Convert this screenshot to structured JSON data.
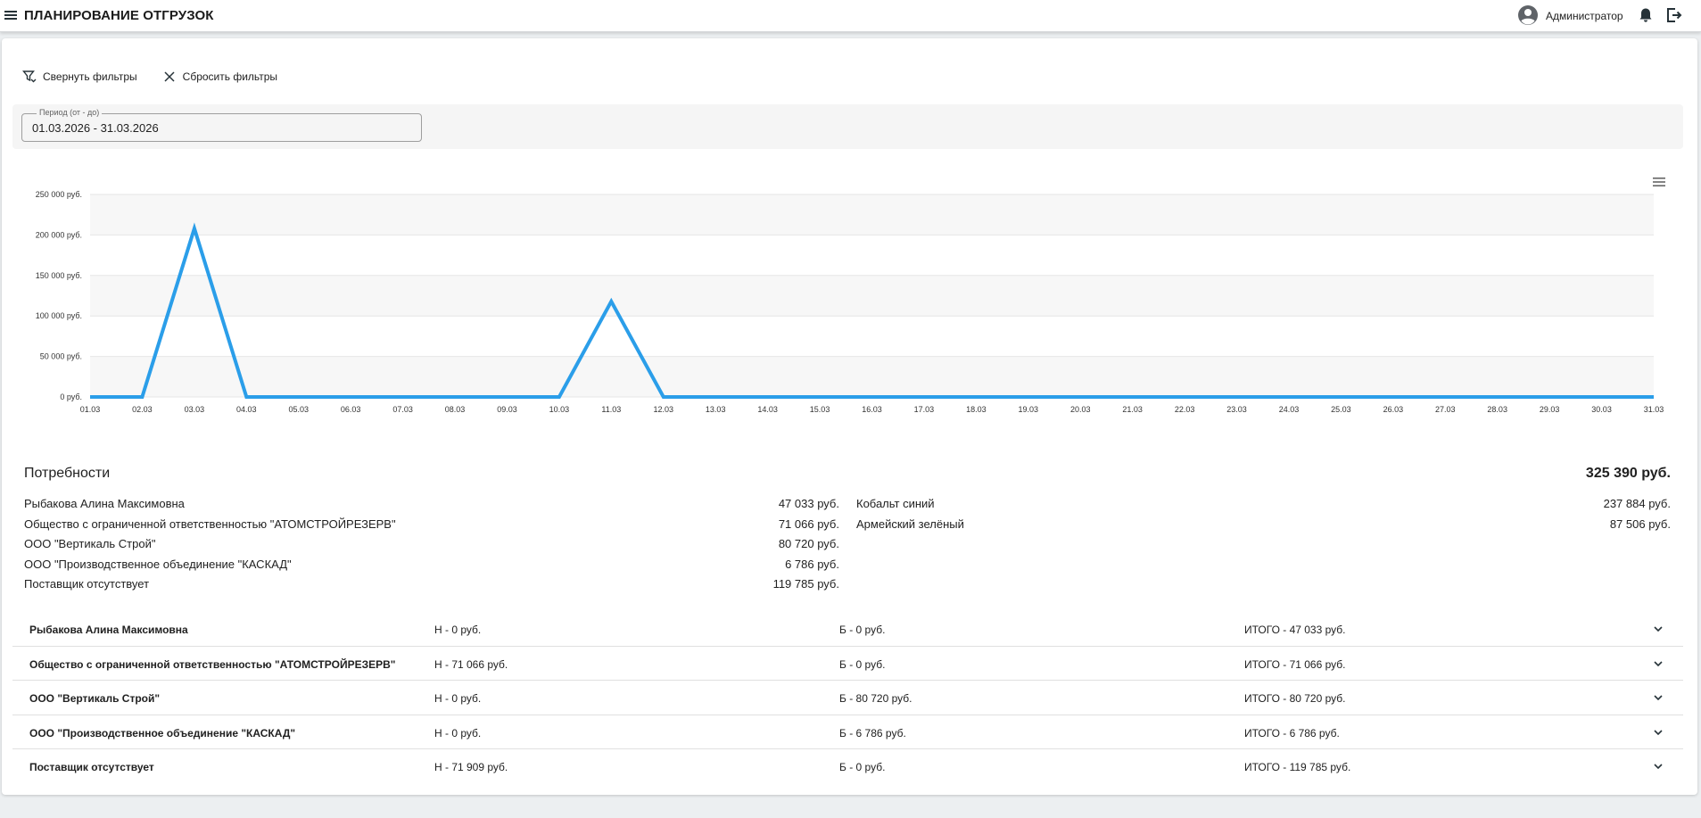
{
  "header": {
    "title": "ПЛАНИРОВАНИЕ ОТГРУЗОК",
    "user_name": "Администратор"
  },
  "filters": {
    "collapse_label": "Свернуть фильтры",
    "reset_label": "Сбросить фильтры",
    "period_label": "Период (от - до)",
    "period_value": "01.03.2026 - 31.03.2026"
  },
  "chart_data": {
    "type": "line",
    "categories": [
      "01.03",
      "02.03",
      "03.03",
      "04.03",
      "05.03",
      "06.03",
      "07.03",
      "08.03",
      "09.03",
      "10.03",
      "11.03",
      "12.03",
      "13.03",
      "14.03",
      "15.03",
      "16.03",
      "17.03",
      "18.03",
      "19.03",
      "20.03",
      "21.03",
      "22.03",
      "23.03",
      "24.03",
      "25.03",
      "26.03",
      "27.03",
      "28.03",
      "29.03",
      "30.03",
      "31.03"
    ],
    "values": [
      0,
      0,
      208000,
      0,
      0,
      0,
      0,
      0,
      0,
      0,
      118000,
      0,
      0,
      0,
      0,
      0,
      0,
      0,
      0,
      0,
      0,
      0,
      0,
      0,
      0,
      0,
      0,
      0,
      0,
      0,
      0
    ],
    "ylim": [
      0,
      250000
    ],
    "yticks": [
      0,
      50000,
      100000,
      150000,
      200000,
      250000
    ],
    "ytick_labels": [
      "0 руб.",
      "50 000 руб.",
      "100 000 руб.",
      "150 000 руб.",
      "200 000 руб.",
      "250 000 руб."
    ],
    "color": "#2b9ee9",
    "grid": true
  },
  "needs": {
    "title": "Потребности",
    "total": "325 390 руб.",
    "suppliers": [
      {
        "name": "Рыбакова Алина Максимовна",
        "amount": "47 033 руб."
      },
      {
        "name": "Общество с ограниченной ответственностью \"АТОМСТРОЙРЕЗЕРВ\"",
        "amount": "71 066 руб."
      },
      {
        "name": "ООО \"Вертикаль Строй\"",
        "amount": "80 720 руб."
      },
      {
        "name": "ООО \"Производственное объединение \"КАСКАД\"",
        "amount": "6 786 руб."
      },
      {
        "name": "Поставщик отсутствует",
        "amount": "119 785 руб."
      }
    ],
    "colors": [
      {
        "name": "Кобальт синий",
        "amount": "237 884 руб."
      },
      {
        "name": "Армейский зелёный",
        "amount": "87 506 руб."
      }
    ]
  },
  "rows": [
    {
      "name": "Рыбакова Алина Максимовна",
      "n": "Н - 0 руб.",
      "b": "Б - 0 руб.",
      "total": "ИТОГО - 47 033 руб."
    },
    {
      "name": "Общество с ограниченной ответственностью \"АТОМСТРОЙРЕЗЕРВ\"",
      "n": "Н - 71 066 руб.",
      "b": "Б - 0 руб.",
      "total": "ИТОГО - 71 066 руб."
    },
    {
      "name": "ООО \"Вертикаль Строй\"",
      "n": "Н - 0 руб.",
      "b": "Б - 80 720 руб.",
      "total": "ИТОГО - 80 720 руб."
    },
    {
      "name": "ООО \"Производственное объединение \"КАСКАД\"",
      "n": "Н - 0 руб.",
      "b": "Б - 6 786 руб.",
      "total": "ИТОГО - 6 786 руб."
    },
    {
      "name": "Поставщик отсутствует",
      "n": "Н - 71 909 руб.",
      "b": "Б - 0 руб.",
      "total": "ИТОГО - 119 785 руб."
    }
  ]
}
